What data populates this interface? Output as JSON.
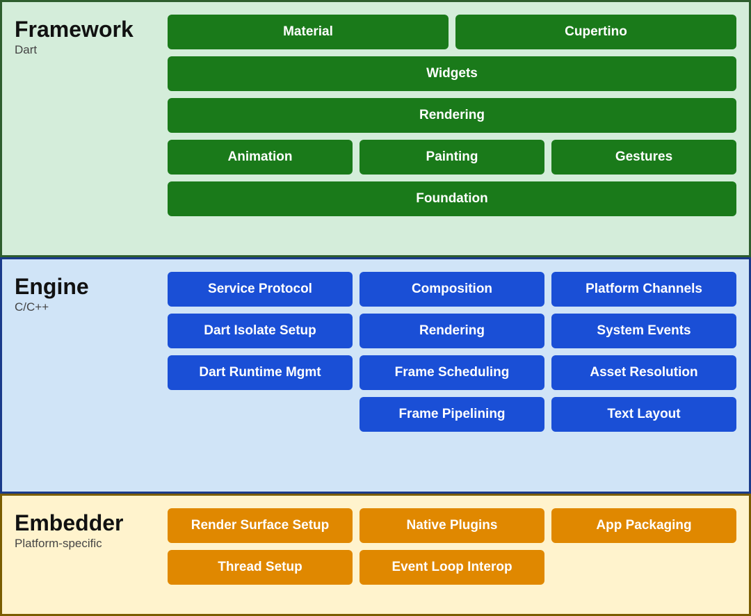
{
  "framework": {
    "title": "Framework",
    "subtitle": "Dart",
    "rows": [
      [
        {
          "label": "Material",
          "span": "half"
        },
        {
          "label": "Cupertino",
          "span": "half"
        }
      ],
      [
        {
          "label": "Widgets",
          "span": "full"
        }
      ],
      [
        {
          "label": "Rendering",
          "span": "full"
        }
      ],
      [
        {
          "label": "Animation",
          "span": "third"
        },
        {
          "label": "Painting",
          "span": "third"
        },
        {
          "label": "Gestures",
          "span": "third"
        }
      ],
      [
        {
          "label": "Foundation",
          "span": "full"
        }
      ]
    ]
  },
  "engine": {
    "title": "Engine",
    "subtitle": "C/C++",
    "rows": [
      [
        {
          "label": "Service Protocol",
          "span": "third"
        },
        {
          "label": "Composition",
          "span": "third"
        },
        {
          "label": "Platform Channels",
          "span": "third"
        }
      ],
      [
        {
          "label": "Dart Isolate Setup",
          "span": "third"
        },
        {
          "label": "Rendering",
          "span": "third"
        },
        {
          "label": "System Events",
          "span": "third"
        }
      ],
      [
        {
          "label": "Dart Runtime Mgmt",
          "span": "third"
        },
        {
          "label": "Frame Scheduling",
          "span": "third"
        },
        {
          "label": "Asset Resolution",
          "span": "third"
        }
      ],
      [
        {
          "label": "",
          "span": "third",
          "empty": true
        },
        {
          "label": "Frame Pipelining",
          "span": "third"
        },
        {
          "label": "Text Layout",
          "span": "third"
        }
      ]
    ]
  },
  "embedder": {
    "title": "Embedder",
    "subtitle": "Platform-specific",
    "rows": [
      [
        {
          "label": "Render Surface Setup",
          "span": "third"
        },
        {
          "label": "Native Plugins",
          "span": "third"
        },
        {
          "label": "App Packaging",
          "span": "third"
        }
      ],
      [
        {
          "label": "Thread Setup",
          "span": "third"
        },
        {
          "label": "Event Loop Interop",
          "span": "third"
        },
        {
          "label": "",
          "span": "third",
          "empty": true
        }
      ]
    ]
  }
}
